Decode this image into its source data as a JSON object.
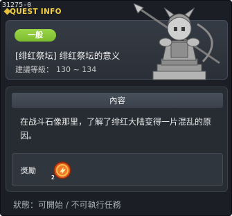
{
  "window": {
    "quest_id": "31275-0",
    "title": "QUEST INFO"
  },
  "header": {
    "category_tag": "一般",
    "quest_name": "[绯红祭坛] 绯红祭坛的意义",
    "level_label": "建議等級：",
    "level_range": "130 ~ 134"
  },
  "content": {
    "heading": "內容",
    "description": "在战斗石像那里，了解了绯红大陆变得一片混乱的原因。",
    "reward_label": "獎勵",
    "reward_count": "2",
    "reward_icon": "exp-orb-icon"
  },
  "status": {
    "text": "狀態：可開始 / 不可執行任務"
  },
  "colors": {
    "title": "#f2cf44",
    "tag_green": "#8cc83a",
    "panel_bg": "#1b1f25",
    "status_text": "#a9b0b8"
  }
}
